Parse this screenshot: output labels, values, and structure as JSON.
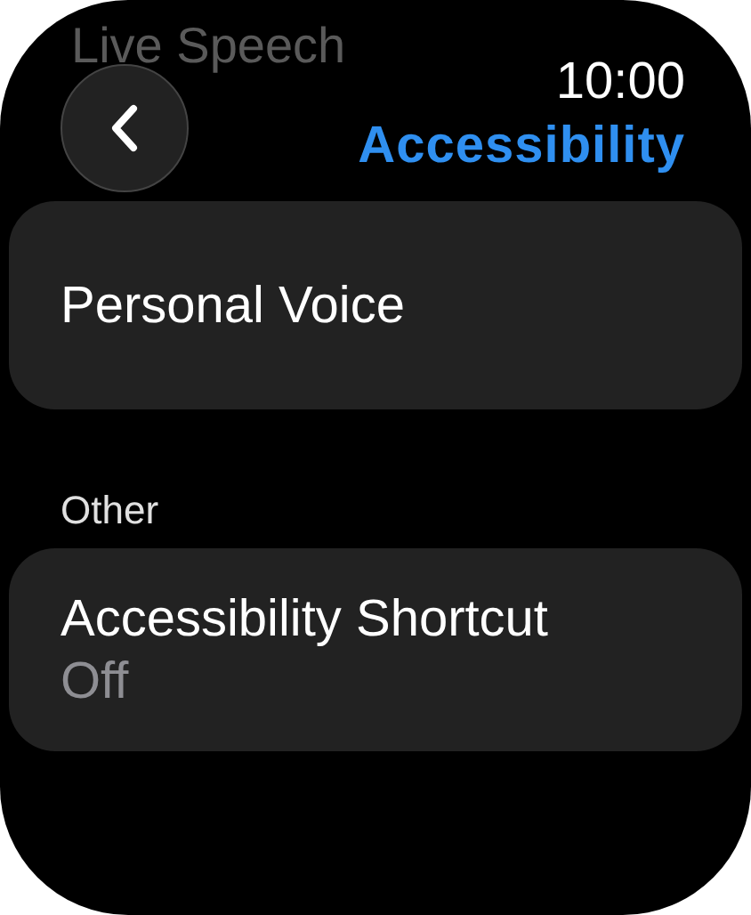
{
  "background_item": "Live Speech",
  "header": {
    "time": "10:00",
    "title": "Accessibility"
  },
  "sections": [
    {
      "items": [
        {
          "title": "Personal Voice"
        }
      ]
    },
    {
      "header": "Other",
      "items": [
        {
          "title": "Accessibility Shortcut",
          "value": "Off"
        }
      ]
    }
  ]
}
